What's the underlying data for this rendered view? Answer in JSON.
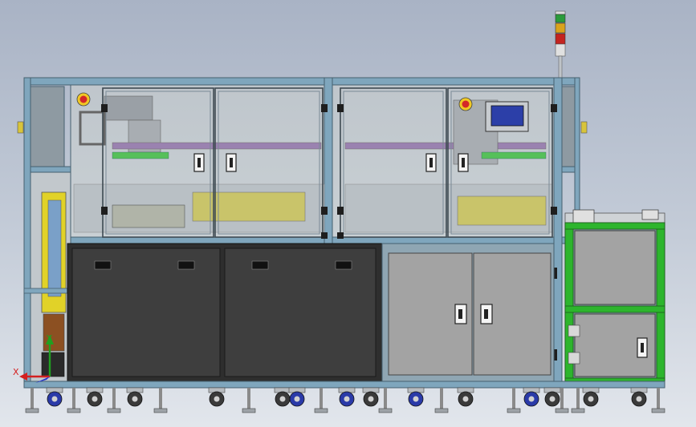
{
  "axis_triad": {
    "x_label": "X",
    "y_label": "Y"
  },
  "colors": {
    "background_top": "#a9b3c5",
    "background_bottom": "#e2e6ec",
    "frame_blue": "#7fa6bd",
    "frame_edge": "#46606f",
    "frame_dark": "#8e9aa2",
    "glass": "#c5ccd2",
    "dark_panel": "#3c3c3c",
    "door_grey": "#a3a3a3",
    "green_frame": "#2db52d",
    "light_stack": [
      "#2a9b3a",
      "#d9a31c",
      "#c42420"
    ],
    "axis_x": "#d42020",
    "axis_y": "#20a020",
    "axis_z": "#2030d0"
  },
  "icons": [
    "emergency-stop-icon",
    "hmi-touchscreen-icon",
    "signal-light-tower-icon",
    "caster-wheel-icon",
    "door-handle-icon",
    "leveling-foot-icon"
  ]
}
